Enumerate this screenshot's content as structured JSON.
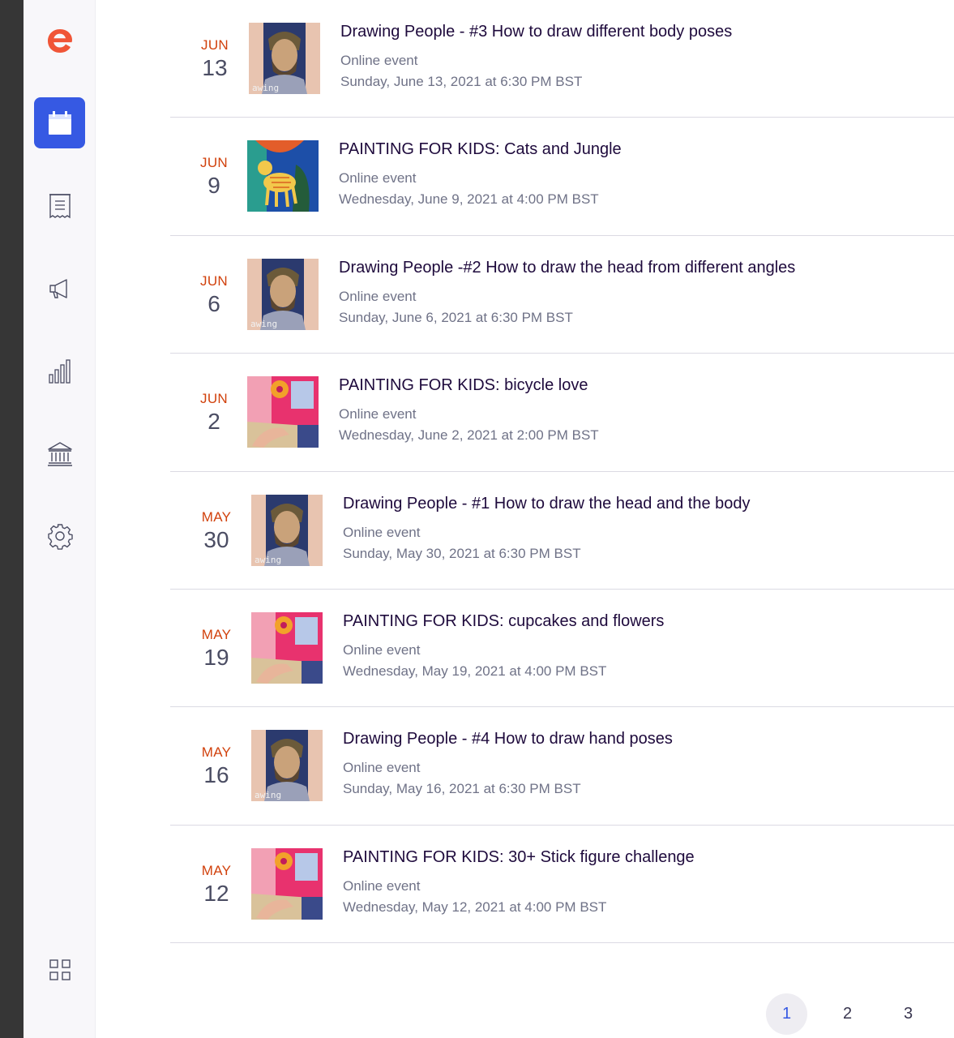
{
  "sidebar": {
    "logo": "eventbrite-e-logo",
    "items": [
      {
        "icon": "calendar-icon",
        "active": true
      },
      {
        "icon": "receipt-icon",
        "active": false
      },
      {
        "icon": "megaphone-icon",
        "active": false
      },
      {
        "icon": "bar-chart-icon",
        "active": false
      },
      {
        "icon": "bank-icon",
        "active": false
      },
      {
        "icon": "gear-icon",
        "active": false
      }
    ],
    "apps_icon": "grid-icon"
  },
  "events": [
    {
      "month": "JUN",
      "day": "13",
      "title": "Drawing People - #3 How to draw different body poses",
      "location": "Online event",
      "datetime": "Sunday, June 13, 2021 at 6:30 PM BST",
      "thumb": "drawing-people"
    },
    {
      "month": "JUN",
      "day": "9",
      "title": "PAINTING FOR KIDS: Cats and Jungle",
      "location": "Online event",
      "datetime": "Wednesday, June 9, 2021 at 4:00 PM BST",
      "thumb": "cat-jungle"
    },
    {
      "month": "JUN",
      "day": "6",
      "title": "Drawing People -#2 How to draw the head from different angles",
      "location": "Online event",
      "datetime": "Sunday, June 6, 2021 at 6:30 PM BST",
      "thumb": "drawing-people"
    },
    {
      "month": "JUN",
      "day": "2",
      "title": "PAINTING FOR KIDS: bicycle love",
      "location": "Online event",
      "datetime": "Wednesday, June 2, 2021 at 2:00 PM BST",
      "thumb": "kids-painting"
    },
    {
      "month": "MAY",
      "day": "30",
      "title": "Drawing People - #1 How to draw the head and the body",
      "location": "Online event",
      "datetime": "Sunday, May 30, 2021 at 6:30 PM BST",
      "thumb": "drawing-people"
    },
    {
      "month": "MAY",
      "day": "19",
      "title": "PAINTING FOR KIDS: cupcakes and flowers",
      "location": "Online event",
      "datetime": "Wednesday, May 19, 2021 at 4:00 PM BST",
      "thumb": "kids-painting"
    },
    {
      "month": "MAY",
      "day": "16",
      "title": "Drawing People - #4 How to draw hand poses",
      "location": "Online event",
      "datetime": "Sunday, May 16, 2021 at 6:30 PM BST",
      "thumb": "drawing-people"
    },
    {
      "month": "MAY",
      "day": "12",
      "title": "PAINTING FOR KIDS: 30+ Stick figure challenge",
      "location": "Online event",
      "datetime": "Wednesday, May 12, 2021 at 4:00 PM BST",
      "thumb": "kids-painting"
    }
  ],
  "thumb_text": "awing",
  "pagination": {
    "pages": [
      "1",
      "2",
      "3"
    ],
    "current": "1"
  },
  "colors": {
    "accent": "#3659e3",
    "month": "#d1410c",
    "brand": "#f05537"
  }
}
